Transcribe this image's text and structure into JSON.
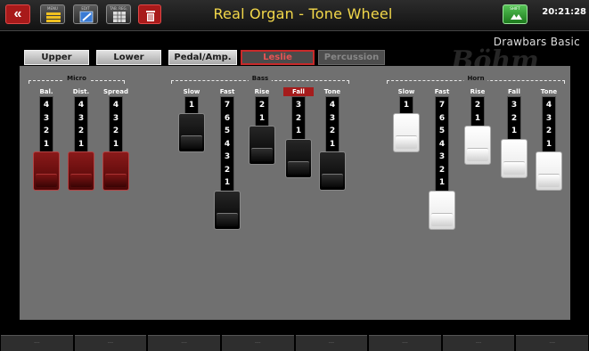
{
  "topbar": {
    "title": "Real Organ - Tone Wheel",
    "time": "20:21:28",
    "back_icon": "«",
    "menu_caption": "MENU",
    "edit_caption": "EDIT",
    "table_caption": "TAB. REG.",
    "shift_caption": "SHIFT",
    "icons": [
      "back-icon",
      "menu-icon",
      "edit-icon",
      "table-icon",
      "trash-icon",
      "shift-icon"
    ]
  },
  "subtitle": "Drawbars Basic",
  "watermark": "Böhm",
  "tabs": [
    {
      "label": "Upper",
      "state": "normal"
    },
    {
      "label": "Lower",
      "state": "normal"
    },
    {
      "label": "Pedal/Amp.",
      "state": "normal"
    },
    {
      "label": "Leslie",
      "state": "active"
    },
    {
      "label": "Percussion",
      "state": "disabled"
    }
  ],
  "groups": [
    {
      "name": "Micro"
    },
    {
      "name": "Bass"
    },
    {
      "name": "Horn"
    }
  ],
  "drawbars": [
    {
      "label": "Bal.",
      "numbers": [
        "4",
        "3",
        "2",
        "1"
      ],
      "style": "red",
      "selected": false
    },
    {
      "label": "Dist.",
      "numbers": [
        "4",
        "3",
        "2",
        "1"
      ],
      "style": "red",
      "selected": false
    },
    {
      "label": "Spread",
      "numbers": [
        "4",
        "3",
        "2",
        "1"
      ],
      "style": "red",
      "selected": false
    },
    {
      "label": "Slow",
      "numbers": [
        "1"
      ],
      "style": "black",
      "selected": false
    },
    {
      "label": "Fast",
      "numbers": [
        "7",
        "6",
        "5",
        "4",
        "3",
        "2",
        "1"
      ],
      "style": "black",
      "selected": false
    },
    {
      "label": "Rise",
      "numbers": [
        "2",
        "1"
      ],
      "style": "black",
      "selected": false
    },
    {
      "label": "Fall",
      "numbers": [
        "3",
        "2",
        "1"
      ],
      "style": "black",
      "selected": true
    },
    {
      "label": "Tone",
      "numbers": [
        "4",
        "3",
        "2",
        "1"
      ],
      "style": "black",
      "selected": false
    },
    {
      "label": "Slow",
      "numbers": [
        "1"
      ],
      "style": "white",
      "selected": false
    },
    {
      "label": "Fast",
      "numbers": [
        "7",
        "6",
        "5",
        "4",
        "3",
        "2",
        "1"
      ],
      "style": "white",
      "selected": false
    },
    {
      "label": "Rise",
      "numbers": [
        "2",
        "1"
      ],
      "style": "white",
      "selected": false
    },
    {
      "label": "Fall",
      "numbers": [
        "3",
        "2",
        "1"
      ],
      "style": "white",
      "selected": false
    },
    {
      "label": "Tone",
      "numbers": [
        "4",
        "3",
        "2",
        "1"
      ],
      "style": "white",
      "selected": false
    }
  ],
  "bottom_buttons": [
    "---",
    "---",
    "---",
    "---",
    "---",
    "---",
    "---",
    "---"
  ],
  "colors": {
    "title": "#f3d84a",
    "active_tab": "#c82a2a",
    "selected_label": "#a51c1c",
    "panel": "#707070"
  }
}
